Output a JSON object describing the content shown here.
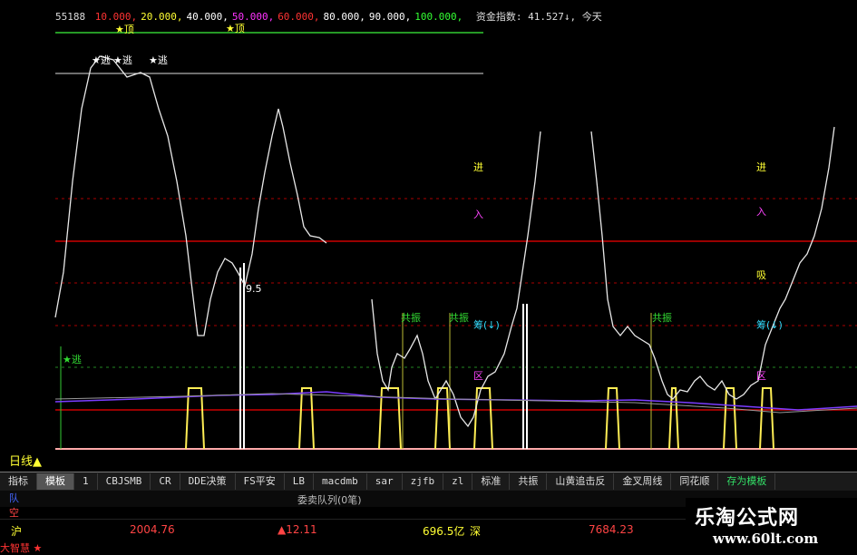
{
  "legend": {
    "code": "55188",
    "items": [
      {
        "text": "10.000,",
        "color": "#ff3333"
      },
      {
        "text": "20.000,",
        "color": "#ffff33"
      },
      {
        "text": "40.000,",
        "color": "#ffffff"
      },
      {
        "text": "50.000,",
        "color": "#ff33ff"
      },
      {
        "text": "60.000,",
        "color": "#ff3333"
      },
      {
        "text": "80.000,",
        "color": "#ffffff"
      },
      {
        "text": "90.000,",
        "color": "#ffffff"
      },
      {
        "text": "100.000,",
        "color": "#33ff33"
      }
    ],
    "fund_index_label": "资金指数: 41.527↓, 今天"
  },
  "annotations": {
    "top": "★顶",
    "escape": "★逃",
    "resonance": "共振",
    "enter": "进",
    "in": "入",
    "absorb": "吸",
    "chip": "筹(↓)",
    "zone": "区",
    "num": "9.5",
    "escape_bottom": "★逃"
  },
  "colors": {
    "main_line": "#e8e8e8",
    "red_line": "#cc0000",
    "dashed_line": "#aa0000",
    "green_dash": "#228822",
    "yellow_trap": "#ffee55",
    "purple": "#7a3cff",
    "top_green": "#33cc33"
  },
  "timeframe": "日线▲",
  "tabs": [
    {
      "label": "指标",
      "selected": false
    },
    {
      "label": "模板",
      "selected": true
    },
    {
      "label": "1",
      "selected": false
    },
    {
      "label": "CBJSMB",
      "selected": false
    },
    {
      "label": "CR",
      "selected": false
    },
    {
      "label": "DDE决策",
      "selected": false
    },
    {
      "label": "FS平安",
      "selected": false
    },
    {
      "label": "LB",
      "selected": false
    },
    {
      "label": "macdmb",
      "selected": false
    },
    {
      "label": "sar",
      "selected": false
    },
    {
      "label": "zjfb",
      "selected": false
    },
    {
      "label": "zl",
      "selected": false
    },
    {
      "label": "标准",
      "selected": false
    },
    {
      "label": "共振",
      "selected": false
    },
    {
      "label": "山黄追击反",
      "selected": false
    },
    {
      "label": "金叉周线",
      "selected": false
    },
    {
      "label": "同花顺",
      "selected": false
    },
    {
      "label": "存为模板",
      "selected": false
    }
  ],
  "queue": {
    "side_label": "队",
    "title": "委卖队列(0笔)",
    "side_label2": "空"
  },
  "status": {
    "market1": "沪",
    "index1": "2004.76",
    "change1": "▲12.11",
    "amount1": "696.5亿",
    "market2": "深",
    "index2": "7684.23"
  },
  "footer": {
    "text": "大智慧 ★"
  },
  "watermark": {
    "title": "乐淘公式网",
    "url": "www.60lt.com"
  }
}
